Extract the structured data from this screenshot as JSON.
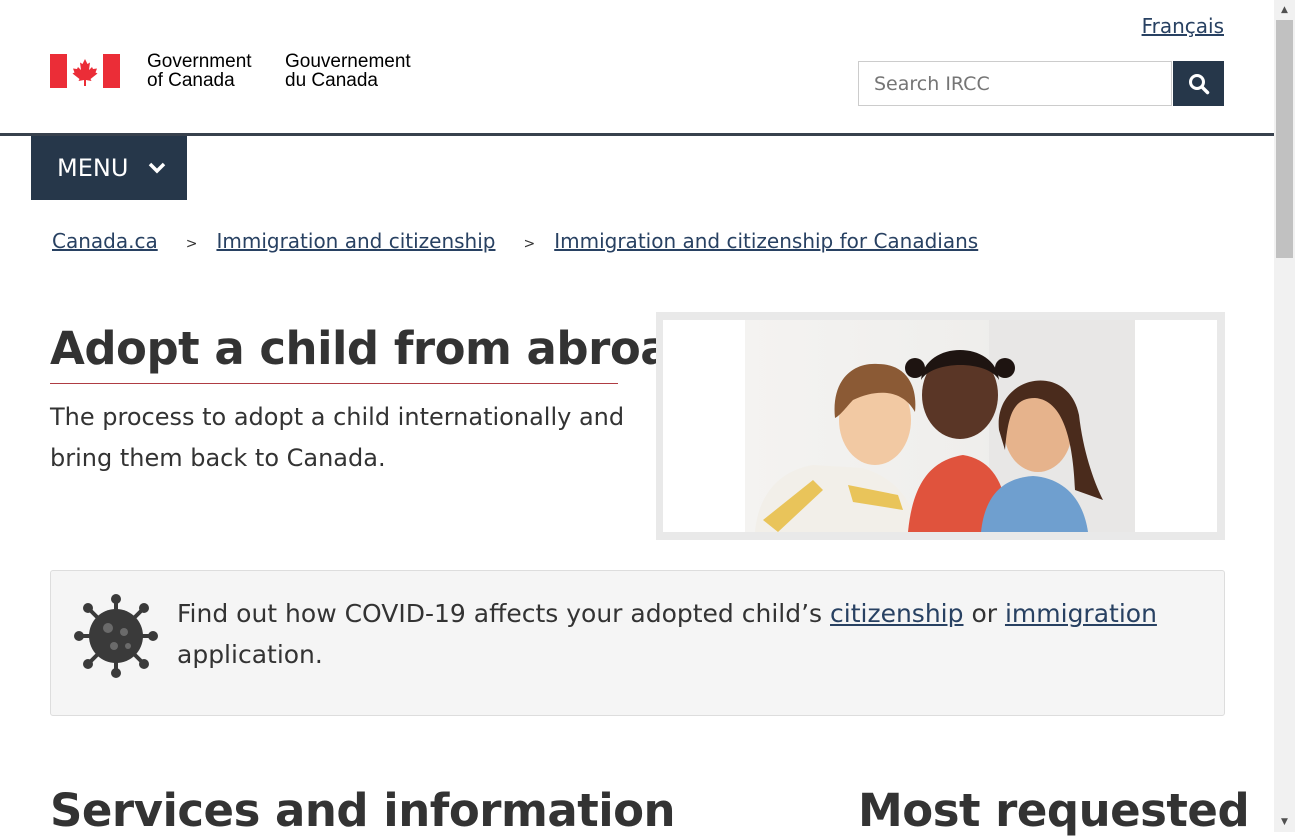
{
  "header": {
    "language_link": "Français",
    "government_en_line1": "Government",
    "government_en_line2": "of Canada",
    "government_fr_line1": "Gouvernement",
    "government_fr_line2": "du Canada",
    "flag_icon": "canada-flag-icon",
    "search_placeholder": "Search IRCC",
    "search_icon": "search-icon"
  },
  "menu": {
    "label": "MENU",
    "icon": "chevron-down-icon"
  },
  "breadcrumb": {
    "separator": ">",
    "items": [
      "Canada.ca",
      "Immigration and citizenship",
      "Immigration and citizenship for Canadians"
    ]
  },
  "hero": {
    "title": "Adopt a child from abroad",
    "lead": "The process to adopt a child internationally and bring them back to Canada."
  },
  "alert": {
    "icon": "coronavirus-icon",
    "text_before": "Find out how COVID-19 affects your adopted child’s ",
    "link1": "citizenship",
    "text_middle": " or ",
    "link2": "immigration",
    "text_after": " application."
  },
  "sections": {
    "left_heading": "Services and information",
    "right_heading": "Most requested"
  },
  "colors": {
    "brand_dark": "#26374a",
    "link": "#284162",
    "flag_red": "#eb2d37",
    "title_rule": "#af3c43"
  }
}
